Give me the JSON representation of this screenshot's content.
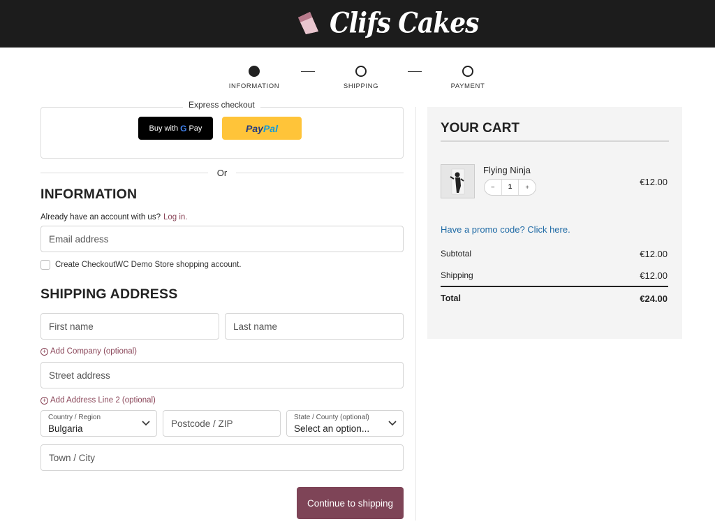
{
  "brand": {
    "name": "Clifs Cakes",
    "accent": "#7e4457",
    "logo_icon": "cake-slice-icon"
  },
  "steps": [
    {
      "label": "INFORMATION",
      "active": true
    },
    {
      "label": "SHIPPING",
      "active": false
    },
    {
      "label": "PAYMENT",
      "active": false
    }
  ],
  "express": {
    "title": "Express checkout",
    "gpay": {
      "prefix": "Buy with",
      "g": "G",
      "suffix": "Pay"
    },
    "paypal": {
      "part1": "Pay",
      "part2": "Pal"
    },
    "or": "Or"
  },
  "information": {
    "heading": "INFORMATION",
    "account_text": "Already have an account with us?",
    "login_link": "Log in.",
    "email_placeholder": "Email address",
    "create_account_label": "Create CheckoutWC Demo Store shopping account."
  },
  "shipping": {
    "heading": "SHIPPING ADDRESS",
    "first_name_placeholder": "First name",
    "last_name_placeholder": "Last name",
    "add_company": "Add Company (optional)",
    "street_placeholder": "Street address",
    "add_line2": "Add Address Line 2 (optional)",
    "country_label": "Country / Region",
    "country_value": "Bulgaria",
    "postcode_placeholder": "Postcode / ZIP",
    "state_label": "State / County (optional)",
    "state_value": "Select an option...",
    "town_placeholder": "Town / City",
    "continue_button": "Continue to shipping"
  },
  "cart": {
    "title": "YOUR CART",
    "item": {
      "name": "Flying Ninja",
      "qty": "1",
      "minus": "−",
      "plus": "+",
      "price": "€12.00"
    },
    "promo": "Have a promo code? Click here.",
    "subtotal_label": "Subtotal",
    "subtotal_value": "€12.00",
    "shipping_label": "Shipping",
    "shipping_value": "€12.00",
    "total_label": "Total",
    "total_value": "€24.00"
  }
}
